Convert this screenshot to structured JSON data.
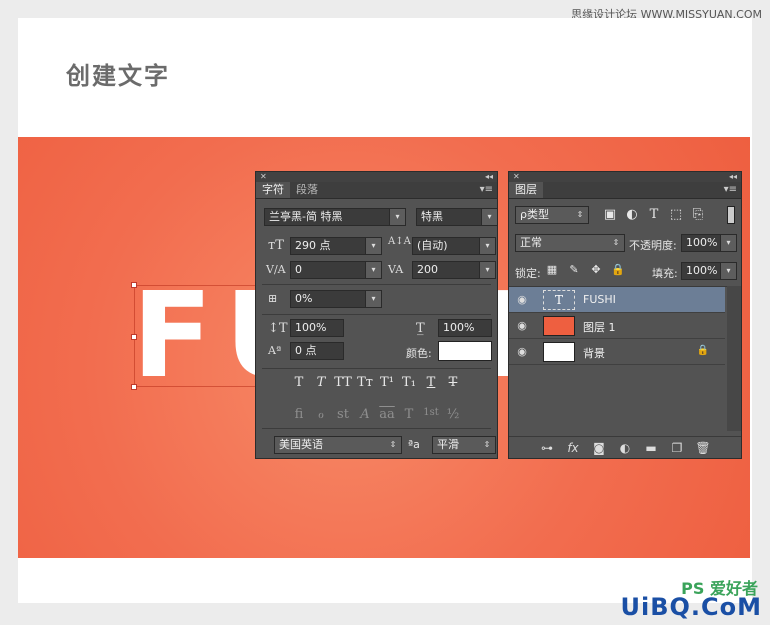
{
  "watermark_top": "思缘设计论坛 WWW.MISSYUAN.COM",
  "heading": "创建文字",
  "canvas_text": "FUSHI",
  "character_panel": {
    "tabs": [
      "字符",
      "段落"
    ],
    "font_family": "兰亭黑-简 特黑",
    "font_style": "特黑",
    "font_size": "290 点",
    "leading": "(自动)",
    "kerning": "0",
    "tracking": "200",
    "tsume": "0%",
    "vertical_scale": "100%",
    "horizontal_scale": "100%",
    "baseline_shift": "0 点",
    "color_label": "颜色:",
    "color": "#ffffff",
    "style_buttons": [
      "T",
      "T",
      "TT",
      "Tт",
      "T¹",
      "T₁",
      "T",
      "T"
    ],
    "opentype_buttons": [
      "fi",
      "ℴ",
      "st",
      "A",
      "aa",
      "T",
      "1st",
      "½"
    ],
    "language": "美国英语",
    "aa_label": "ªa",
    "antialias": "平滑"
  },
  "layers_panel": {
    "tab": "图层",
    "filter_kind": "ρ类型",
    "blend_mode": "正常",
    "opacity_label": "不透明度:",
    "opacity": "100%",
    "lock_label": "锁定:",
    "fill_label": "填充:",
    "fill": "100%",
    "layers": [
      {
        "name": "FUSHI",
        "type": "text",
        "selected": true
      },
      {
        "name": "图层 1",
        "type": "color",
        "color": "#ee5f40"
      },
      {
        "name": "背景",
        "type": "white",
        "locked": true
      }
    ],
    "filter_icons": [
      "image-icon",
      "adjust-icon",
      "type-icon",
      "shape-icon",
      "smart-icon"
    ],
    "bottom_icons": [
      "link-icon",
      "fx-icon",
      "mask-icon",
      "adjustment-icon",
      "folder-icon",
      "new-layer-icon",
      "trash-icon"
    ]
  },
  "colors": {
    "canvas": "#f26d4f",
    "panel_bg": "#535353",
    "selected_layer": "#6c7e96"
  },
  "watermark_bottom": "UiBQ.CoM",
  "watermark_bottom_ps": "PS 爱好者"
}
